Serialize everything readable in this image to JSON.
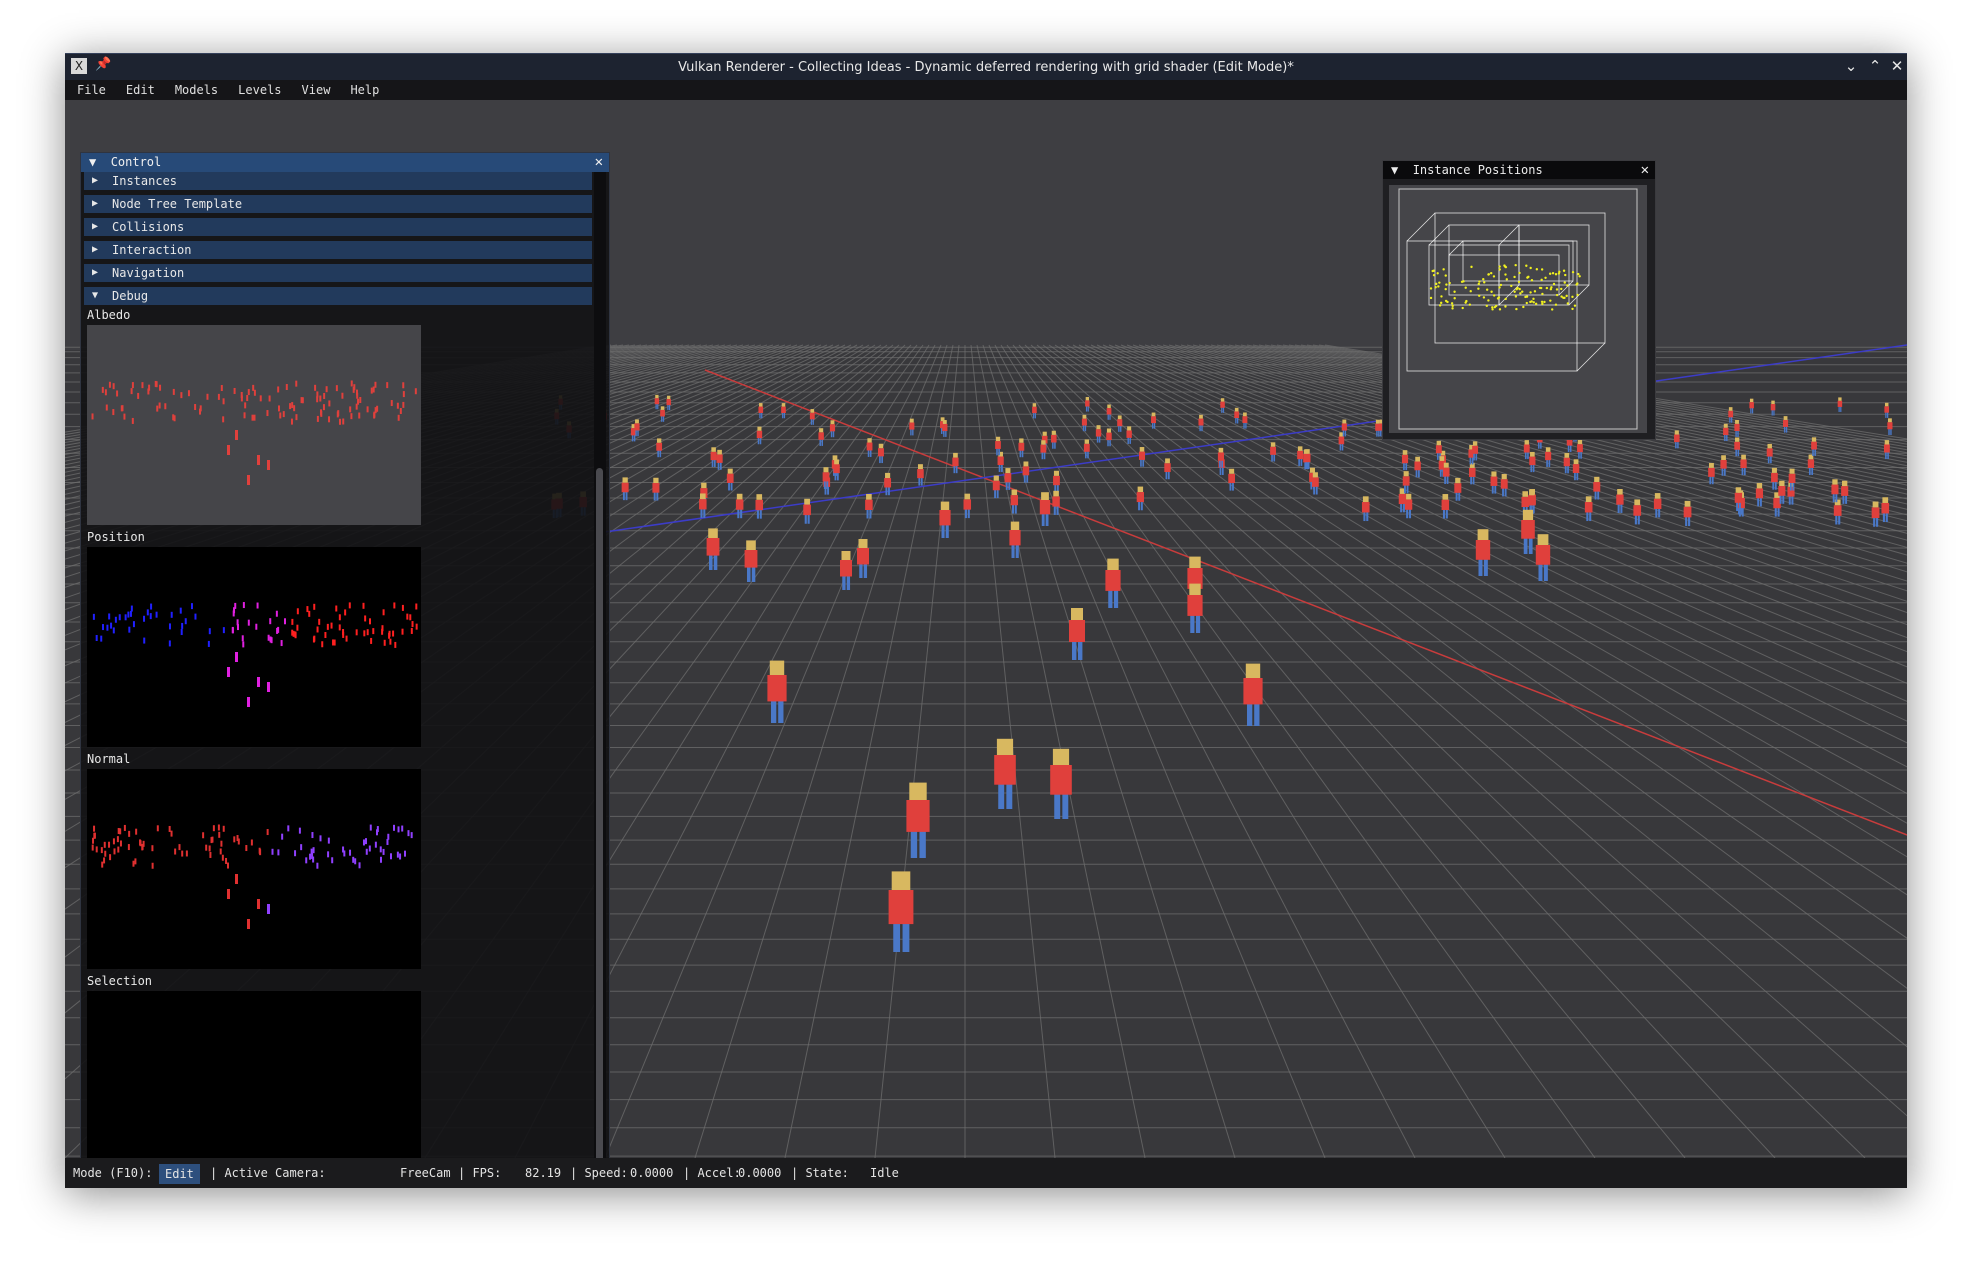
{
  "window": {
    "title": "Vulkan Renderer - Collecting Ideas - Dynamic deferred rendering with grid shader (Edit Mode)*",
    "app_icon": "x-app-icon",
    "minimize_glyph": "⌄",
    "maximize_glyph": "⌃",
    "close_glyph": "✕"
  },
  "menu": [
    "File",
    "Edit",
    "Models",
    "Levels",
    "View",
    "Help"
  ],
  "control_panel": {
    "title": "Control",
    "expanded_glyph": "▼",
    "collapsed_glyph": "▶",
    "close_glyph": "✕",
    "sections": [
      {
        "label": "Instances",
        "expanded": false
      },
      {
        "label": "Node Tree Template",
        "expanded": false
      },
      {
        "label": "Collisions",
        "expanded": false
      },
      {
        "label": "Interaction",
        "expanded": false
      },
      {
        "label": "Navigation",
        "expanded": false
      },
      {
        "label": "Debug",
        "expanded": true
      }
    ],
    "debug_views": [
      "Albedo",
      "Position",
      "Normal",
      "Selection"
    ]
  },
  "instance_positions": {
    "title": "Instance Positions",
    "expanded_glyph": "▼",
    "close_glyph": "✕"
  },
  "status": {
    "mode_label": "Mode (F10):",
    "mode_value": "Edit",
    "camera_label": "| Active Camera:",
    "camera_value": "FreeCam",
    "fps_label": "| FPS:",
    "fps_value": "82.19",
    "speed_label": "| Speed:",
    "speed_value": "0.0000",
    "accel_label": "| Accel:",
    "accel_value": "0.0000",
    "state_label": "| State:",
    "state_value": "Idle"
  },
  "colors": {
    "grid_line": "#6e6e6e",
    "axis_red": "#c83c3c",
    "axis_blue": "#3c3cc8",
    "shirt": "#e0403c",
    "pants": "#4a78c8",
    "hair": "#d8b860",
    "header_blue": "#274a78"
  }
}
